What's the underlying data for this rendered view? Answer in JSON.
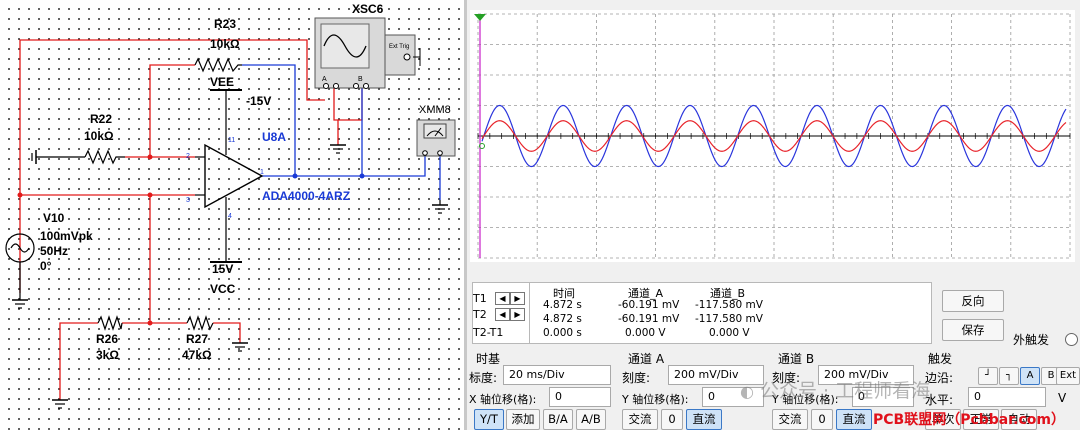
{
  "schematic": {
    "r23": {
      "name": "R23",
      "value": "10kΩ"
    },
    "vee": {
      "name": "VEE",
      "value": "-15V"
    },
    "r22": {
      "name": "R22",
      "value": "10kΩ"
    },
    "opamp": {
      "name": "U8A",
      "part": "ADA4000-4ARZ"
    },
    "v10": {
      "name": "V10",
      "amp": "100mVpk",
      "freq": "50Hz",
      "phase": "0°"
    },
    "vcc": {
      "name": "VCC",
      "value": "15V"
    },
    "r26": {
      "name": "R26",
      "value": "3kΩ"
    },
    "r27": {
      "name": "R27",
      "value": "47kΩ"
    },
    "xsc": {
      "name": "XSC6",
      "ext_trig": "Ext Trig",
      "a": "A",
      "b": "B"
    },
    "xmm": {
      "name": "XMM8"
    },
    "pin_labels": {
      "inv": "2",
      "noninv": "3",
      "out": "1",
      "v_plus": "4",
      "v_minus": "11"
    }
  },
  "scope": {
    "cursor_table": {
      "headers": [
        "时间",
        "通道_A",
        "通道_B"
      ],
      "rows": [
        {
          "label": "T1",
          "time": "4.872 s",
          "a": "-60.191 mV",
          "b": "-117.580 mV"
        },
        {
          "label": "T2",
          "time": "4.872 s",
          "a": "-60.191 mV",
          "b": "-117.580 mV"
        },
        {
          "label": "T2-T1",
          "time": "0.000 s",
          "a": "0.000 V",
          "b": "0.000 V"
        }
      ]
    },
    "reverse_button": "反向",
    "save_button": "保存",
    "ext_trigger_label": "外触发",
    "timebase": {
      "title": "时基",
      "scale_label": "标度:",
      "scale_value": "20 ms/Div",
      "xpos_label": "X 轴位移(格):",
      "xpos_value": "0",
      "btn_yt": "Y/T",
      "btn_add": "添加",
      "btn_ba": "B/A",
      "btn_ab": "A/B"
    },
    "channel_a": {
      "title": "通道 A",
      "scale_label": "刻度:",
      "scale_value": "200 mV/Div",
      "ypos_label": "Y 轴位移(格):",
      "ypos_value": "0",
      "btn_ac": "交流",
      "btn_zero": "0",
      "btn_dc": "直流"
    },
    "channel_b": {
      "title": "通道 B",
      "scale_label": "刻度:",
      "scale_value": "200 mV/Div",
      "ypos_label": "Y 轴位移(格):",
      "ypos_value": "0",
      "btn_ac": "交流",
      "btn_zero": "0",
      "btn_dc": "直流"
    },
    "trigger": {
      "title": "触发",
      "edge_label": "边沿:",
      "level_label": "水平:",
      "level_value": "0",
      "level_unit": "V",
      "btn_ext": "Ext",
      "btn_single": "单次",
      "btn_normal": "正常",
      "btn_auto": "自动"
    },
    "waveforms": {
      "a_color": "#e8242b",
      "b_color": "#2a35dc",
      "a_amplitude_div": 0.5,
      "b_amplitude_div": 1.0,
      "cycles": 9.2,
      "phase_deg": -10
    }
  },
  "watermark": {
    "wechat": "公众号 · 工程师看海",
    "site": "PCB联盟网（Pcbbar.com）"
  }
}
